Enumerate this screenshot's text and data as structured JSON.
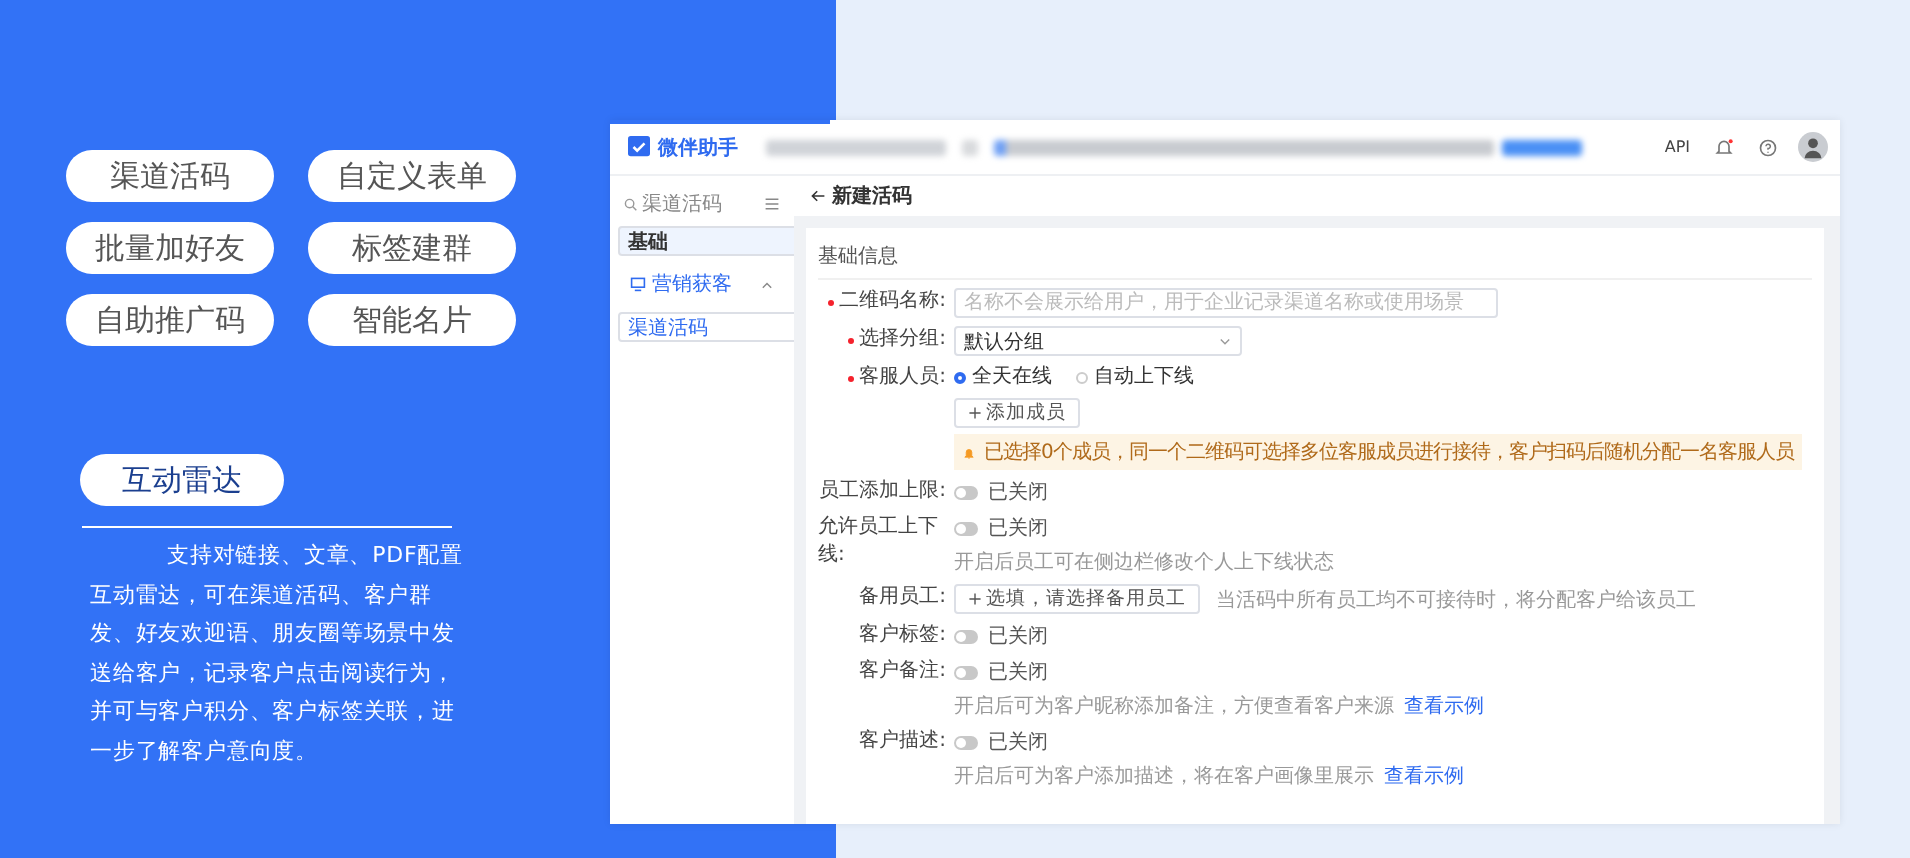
{
  "feature_tags": [
    "渠道活码",
    "自定义表单",
    "批量加好友",
    "标签建群",
    "自助推广码",
    "智能名片"
  ],
  "highlight": {
    "label": "互动雷达",
    "description": "支持对链接、文章、PDF配置互动雷达，可在渠道活码、客户群发、好友欢迎语、朋友圈等场景中发送给客户，记录客户点击阅读行为，并可与客户积分、客户标签关联，进一步了解客户意向度。"
  },
  "app_window": {
    "brand": "微伴助手",
    "header_link": "API",
    "sidebar": {
      "search_placeholder": "渠道活码",
      "items": [
        {
          "label": "基础",
          "selected": true
        },
        {
          "label": "营销获客",
          "selected": false,
          "expanded": true,
          "children": [
            {
              "label": "渠道活码",
              "selected": true
            }
          ]
        }
      ]
    },
    "page_title": "新建活码",
    "form": {
      "section_title": "基础信息",
      "fields": [
        {
          "kind": "text",
          "label": "二维码名称:",
          "required": true,
          "placeholder": "名称不会展示给用户，用于企业记录渠道名称或使用场景"
        },
        {
          "kind": "select",
          "label": "选择分组:",
          "required": true,
          "value": "默认分组"
        },
        {
          "kind": "radio",
          "label": "客服人员:",
          "required": true,
          "options": [
            {
              "label": "全天在线",
              "selected": true
            },
            {
              "label": "自动上下线",
              "selected": false
            }
          ],
          "button": "添加成员",
          "notice": "已选择0个成员，同一个二维码可选择多位客服成员进行接待，客户扫码后随机分配一名客服人员"
        },
        {
          "kind": "toggle",
          "label": "员工添加上限:",
          "required": false,
          "on": false,
          "status": "已关闭"
        },
        {
          "kind": "toggle",
          "label": "允许员工上下线:",
          "required": false,
          "on": false,
          "status": "已关闭",
          "hint": "开启后员工可在侧边栏修改个人上下线状态"
        },
        {
          "kind": "picker",
          "label": "备用员工:",
          "required": false,
          "button": "选填，请选择备用员工",
          "hint": "当活码中所有员工均不可接待时，将分配客户给该员工"
        },
        {
          "kind": "toggle",
          "label": "客户标签:",
          "required": false,
          "on": false,
          "status": "已关闭"
        },
        {
          "kind": "toggle",
          "label": "客户备注:",
          "required": false,
          "on": false,
          "status": "已关闭",
          "hint": "开启后可为客户昵称添加备注，方便查看客户来源",
          "link": "查看示例"
        },
        {
          "kind": "toggle",
          "label": "客户描述:",
          "required": false,
          "on": false,
          "status": "已关闭",
          "hint": "开启后可为客户添加描述，将在客户画像里展示",
          "link": "查看示例"
        }
      ]
    }
  }
}
